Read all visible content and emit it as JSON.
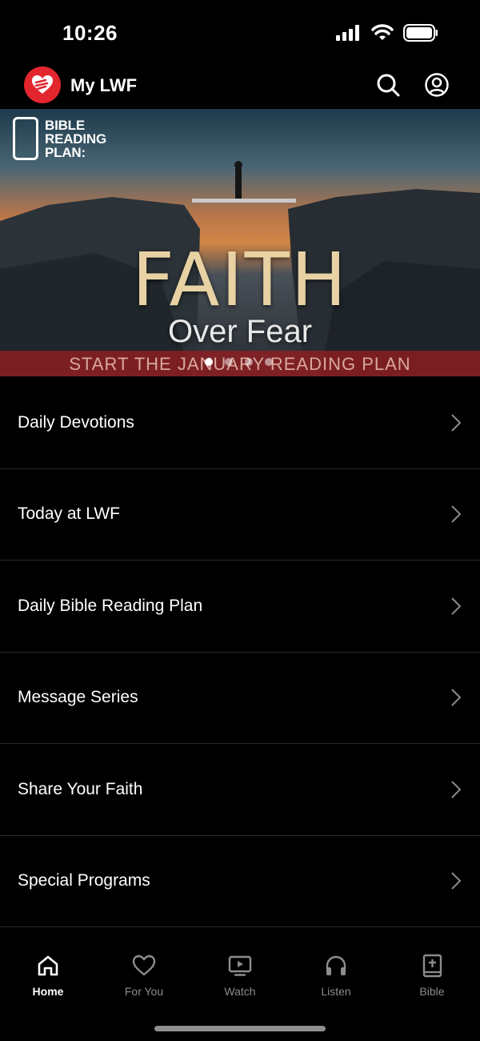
{
  "status_bar": {
    "time": "10:26"
  },
  "header": {
    "title": "My LWF"
  },
  "banner": {
    "plan_label": "BIBLE READING PLAN:",
    "title": "FAITH",
    "subtitle": "Over Fear",
    "cta": "START THE JANUARY READING PLAN",
    "slide_count": 4,
    "active_slide": 0
  },
  "menu": {
    "items": [
      {
        "label": "Daily Devotions"
      },
      {
        "label": "Today at LWF"
      },
      {
        "label": "Daily Bible Reading Plan"
      },
      {
        "label": "Message Series"
      },
      {
        "label": "Share Your Faith"
      },
      {
        "label": "Special Programs"
      }
    ]
  },
  "tabs": [
    {
      "label": "Home",
      "icon": "home-icon",
      "active": true
    },
    {
      "label": "For You",
      "icon": "heart-icon",
      "active": false
    },
    {
      "label": "Watch",
      "icon": "tv-play-icon",
      "active": false
    },
    {
      "label": "Listen",
      "icon": "headphones-icon",
      "active": false
    },
    {
      "label": "Bible",
      "icon": "book-plus-icon",
      "active": false
    }
  ],
  "colors": {
    "accent": "#e3262e",
    "background": "#000000",
    "inactive_tab": "#8c8c8c"
  }
}
